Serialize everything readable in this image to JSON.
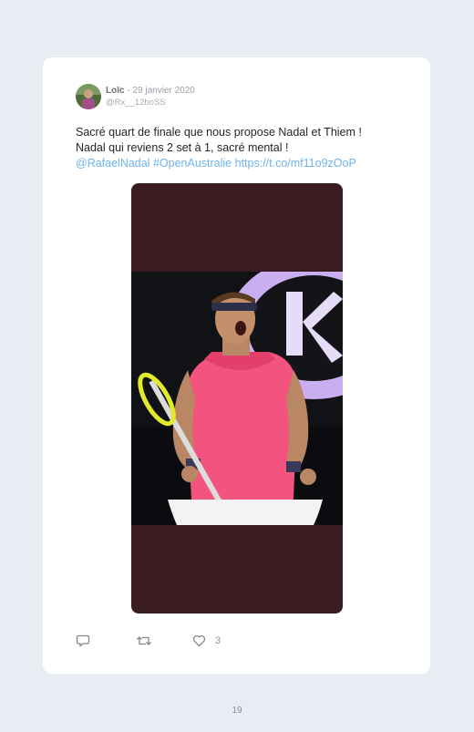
{
  "tweet": {
    "author_name": "Loïc",
    "separator": " - ",
    "date": "29 janvier 2020",
    "handle": "@Rx__12boSS",
    "text_line1": "Sacré quart de finale que nous propose Nadal et Thiem !",
    "text_line2": "Nadal qui reviens 2 set à 1, sacré mental !",
    "mention": "@RafaelNadal",
    "hashtag": "#OpenAustralie",
    "url": "https://t.co/mf11o9zOoP",
    "like_count": "3"
  },
  "icons": {
    "reply": "reply-icon",
    "retweet": "retweet-icon",
    "like": "heart-icon"
  },
  "colors": {
    "page_background": "#e8ecf3",
    "card_background": "#ffffff",
    "link": "#6fb3ea",
    "media_background": "#3b1b22"
  },
  "page": {
    "number": "19"
  }
}
